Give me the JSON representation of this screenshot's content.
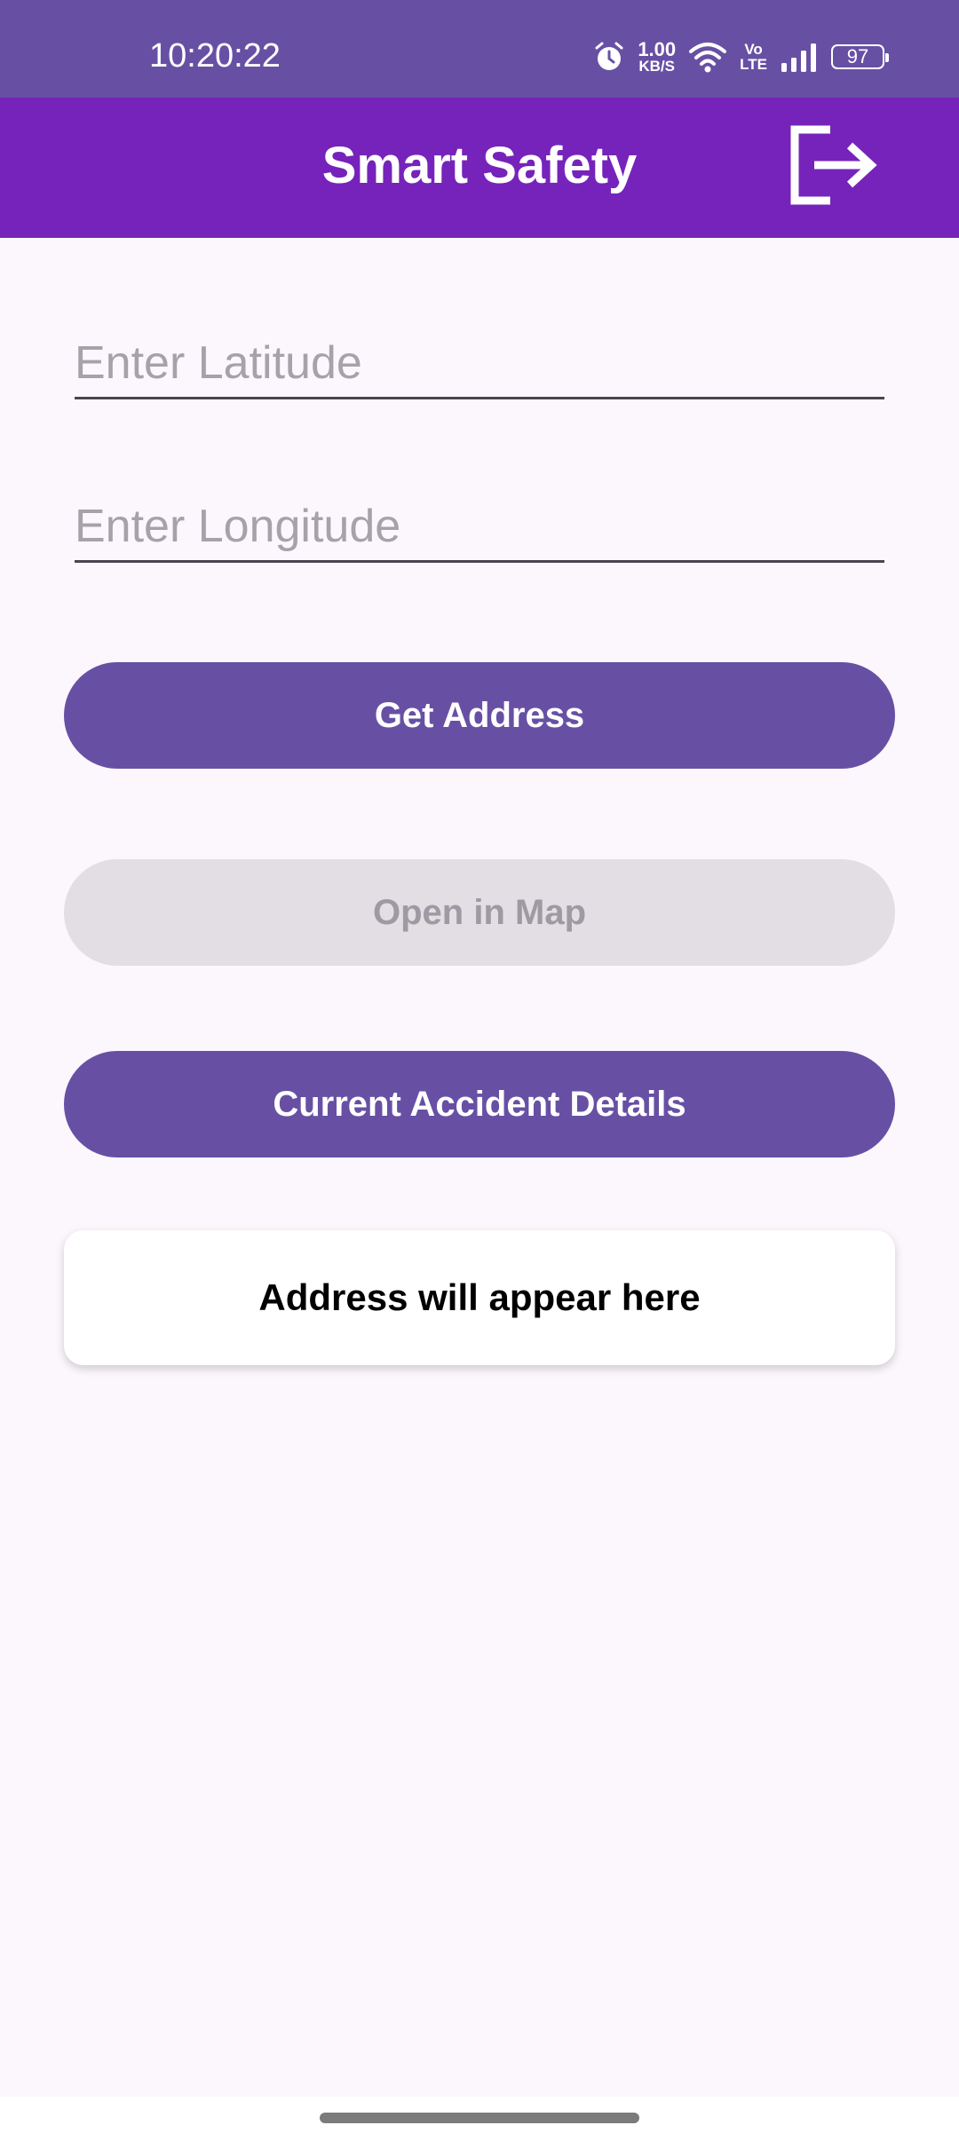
{
  "status_bar": {
    "time": "10:20:22",
    "net_speed_value": "1.00",
    "net_speed_unit": "KB/S",
    "volte_top": "Vo",
    "volte_bottom": "LTE",
    "battery": "97",
    "icons": [
      "alarm-icon",
      "wifi-icon",
      "signal-icon",
      "battery-icon"
    ]
  },
  "app_bar": {
    "title": "Smart Safety",
    "logout_icon": "logout-icon"
  },
  "form": {
    "latitude_placeholder": "Enter Latitude",
    "latitude_value": "",
    "longitude_placeholder": "Enter Longitude",
    "longitude_value": ""
  },
  "buttons": {
    "get_address": "Get Address",
    "open_in_map": "Open in Map",
    "current_accident_details": "Current Accident Details"
  },
  "address_card": {
    "text": "Address will appear here"
  },
  "colors": {
    "status_bar": "#6750a4",
    "app_bar": "#7623bb",
    "primary_button": "#6750a4",
    "disabled_button": "#e3dde4",
    "background": "#fcf7fc"
  }
}
